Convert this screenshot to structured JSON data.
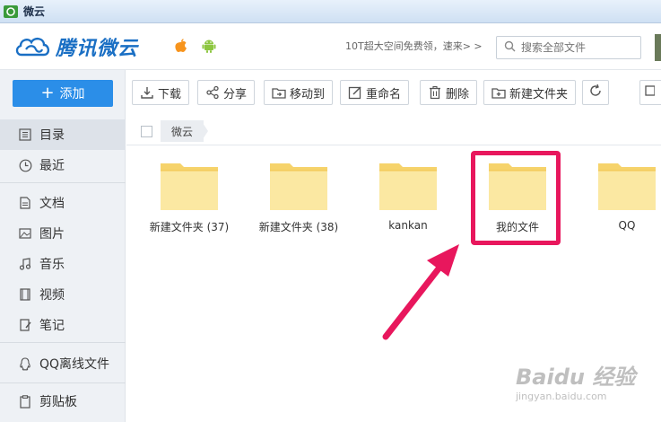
{
  "window": {
    "title": "微云"
  },
  "header": {
    "logo_text": "腾讯微云",
    "promo": "10T超大空间免费领，速来> >",
    "search_placeholder": "搜索全部文件"
  },
  "sidebar": {
    "add_label": "添加",
    "items": [
      {
        "label": "目录",
        "icon": "list-icon"
      },
      {
        "label": "最近",
        "icon": "clock-icon"
      },
      {
        "label": "文档",
        "icon": "document-icon"
      },
      {
        "label": "图片",
        "icon": "image-icon"
      },
      {
        "label": "音乐",
        "icon": "music-icon"
      },
      {
        "label": "视频",
        "icon": "video-icon"
      },
      {
        "label": "笔记",
        "icon": "note-icon"
      },
      {
        "label": "QQ离线文件",
        "icon": "qq-icon"
      },
      {
        "label": "剪贴板",
        "icon": "clipboard-icon"
      }
    ]
  },
  "toolbar": {
    "download": "下载",
    "share": "分享",
    "move": "移动到",
    "rename": "重命名",
    "delete": "删除",
    "new_folder": "新建文件夹"
  },
  "breadcrumb": {
    "current": "微云"
  },
  "files": [
    {
      "name": "新建文件夹 (37)"
    },
    {
      "name": "新建文件夹 (38)"
    },
    {
      "name": "kankan"
    },
    {
      "name": "我的文件"
    },
    {
      "name": "QQ"
    }
  ],
  "watermark": {
    "main": "Baidu 经验",
    "sub": "jingyan.baidu.com"
  },
  "colors": {
    "accent": "#2b8ee8",
    "highlight": "#e8175d",
    "folder": "#f9e08a"
  }
}
